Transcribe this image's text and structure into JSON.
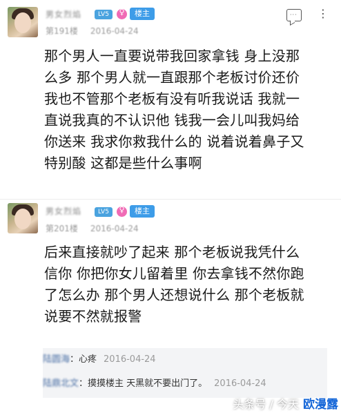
{
  "posts": [
    {
      "username": "男女烈焰",
      "level": "LV5",
      "host_badge": "楼主",
      "floor": "第191楼",
      "date": "2016-04-24",
      "content_lines": [
        "那个男人一直要说带我回家拿钱 身上没那",
        "么多 那个男人就一直跟那个老板讨价还价",
        "我也不管那个老板有没有听我说话 我就一",
        "直说我真的不认识他 钱我一会儿叫我妈给",
        "你送来 我求你救我什么的 说着说着鼻子又",
        "特别酸 这都是些什么事啊"
      ]
    },
    {
      "username": "男女烈焰",
      "level": "LV5",
      "host_badge": "楼主",
      "floor": "第201楼",
      "date": "2016-04-24",
      "content_lines": [
        "后来直接就吵了起来 那个老板说我凭什么",
        "信你 你把你女儿留着里 你去拿钱不然你跑",
        "了怎么办 那个男人还想说什么 那个老板就",
        "说要不然就报警"
      ]
    }
  ],
  "replies": [
    {
      "user": "陆圆海",
      "text": "：心疼",
      "date": "2016-04-24"
    },
    {
      "user": "陆鼎北文",
      "text": "：摸摸楼主 天黑就不要出门了。",
      "date": "2016-04-24"
    }
  ],
  "watermark": {
    "source": "头条号 / 今天",
    "brand": "欧漫露"
  },
  "colors": {
    "level_badge": "#4aa3df",
    "host_badge": "#3d9ce8",
    "gender_icon": "#f06bb5",
    "reply_background": "#f3f4f6",
    "brand": "#1667d8"
  },
  "icons": {
    "comment": "comment-bubble-icon",
    "more": "more-options-icon",
    "gender": "female-icon"
  }
}
